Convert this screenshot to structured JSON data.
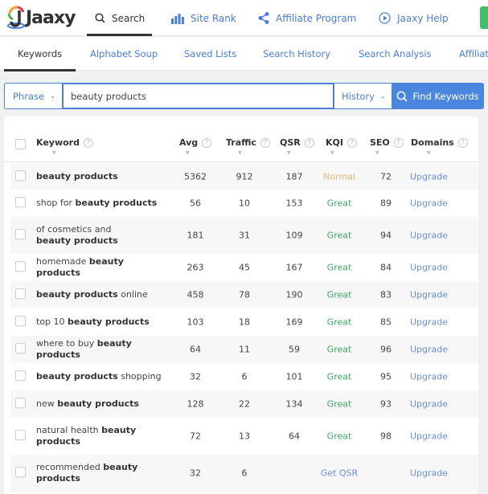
{
  "app": {
    "name": "Jaaxy"
  },
  "topnav": {
    "items": [
      {
        "label": "Search",
        "icon": "search-icon",
        "active": true
      },
      {
        "label": "Site Rank",
        "icon": "bar-chart-icon",
        "active": false
      },
      {
        "label": "Affiliate Program",
        "icon": "share-icon",
        "active": false
      },
      {
        "label": "Jaaxy Help",
        "icon": "play-circle-icon",
        "active": false
      }
    ]
  },
  "subnav": {
    "items": [
      {
        "label": "Keywords",
        "active": true
      },
      {
        "label": "Alphabet Soup",
        "active": false
      },
      {
        "label": "Saved Lists",
        "active": false
      },
      {
        "label": "Search History",
        "active": false
      },
      {
        "label": "Search Analysis",
        "active": false
      },
      {
        "label": "Affiliate Programs",
        "active": false
      }
    ]
  },
  "search": {
    "mode": "Phrase",
    "query": "beauty products",
    "history_label": "History",
    "button_label": "Find Keywords"
  },
  "table": {
    "columns": [
      "Keyword",
      "Avg",
      "Traffic",
      "QSR",
      "KQI",
      "SEO",
      "Domains"
    ],
    "rows": [
      {
        "pre": "",
        "bold": "beauty products",
        "post": "",
        "avg": "5362",
        "traffic": "912",
        "qsr": "187",
        "kqi": "Normal",
        "kqi_type": "normal",
        "seo": "72",
        "domains": "Upgrade"
      },
      {
        "pre": "shop for ",
        "bold": "beauty products",
        "post": "",
        "avg": "56",
        "traffic": "10",
        "qsr": "153",
        "kqi": "Great",
        "kqi_type": "great",
        "seo": "89",
        "domains": "Upgrade"
      },
      {
        "pre": "of cosmetics and ",
        "bold": "beauty products",
        "post": "",
        "avg": "181",
        "traffic": "31",
        "qsr": "109",
        "kqi": "Great",
        "kqi_type": "great",
        "seo": "94",
        "domains": "Upgrade"
      },
      {
        "pre": "homemade ",
        "bold": "beauty products",
        "post": "",
        "avg": "263",
        "traffic": "45",
        "qsr": "167",
        "kqi": "Great",
        "kqi_type": "great",
        "seo": "84",
        "domains": "Upgrade"
      },
      {
        "pre": "",
        "bold": "beauty products",
        "post": " online",
        "avg": "458",
        "traffic": "78",
        "qsr": "190",
        "kqi": "Great",
        "kqi_type": "great",
        "seo": "83",
        "domains": "Upgrade"
      },
      {
        "pre": "top 10 ",
        "bold": "beauty products",
        "post": "",
        "avg": "103",
        "traffic": "18",
        "qsr": "169",
        "kqi": "Great",
        "kqi_type": "great",
        "seo": "85",
        "domains": "Upgrade"
      },
      {
        "pre": "where to buy ",
        "bold": "beauty products",
        "post": "",
        "avg": "64",
        "traffic": "11",
        "qsr": "59",
        "kqi": "Great",
        "kqi_type": "great",
        "seo": "96",
        "domains": "Upgrade"
      },
      {
        "pre": "",
        "bold": "beauty products",
        "post": " shopping",
        "avg": "32",
        "traffic": "6",
        "qsr": "101",
        "kqi": "Great",
        "kqi_type": "great",
        "seo": "95",
        "domains": "Upgrade"
      },
      {
        "pre": "new ",
        "bold": "beauty products",
        "post": "",
        "avg": "128",
        "traffic": "22",
        "qsr": "134",
        "kqi": "Great",
        "kqi_type": "great",
        "seo": "93",
        "domains": "Upgrade"
      },
      {
        "pre": "natural health ",
        "bold": "beauty products",
        "post": "",
        "avg": "72",
        "traffic": "13",
        "qsr": "64",
        "kqi": "Great",
        "kqi_type": "great",
        "seo": "98",
        "domains": "Upgrade"
      },
      {
        "pre": "recommended ",
        "bold": "beauty products",
        "post": "",
        "avg": "32",
        "traffic": "6",
        "qsr": "",
        "kqi": "Get QSR",
        "kqi_type": "link",
        "seo": "",
        "domains": "Upgrade"
      }
    ]
  }
}
